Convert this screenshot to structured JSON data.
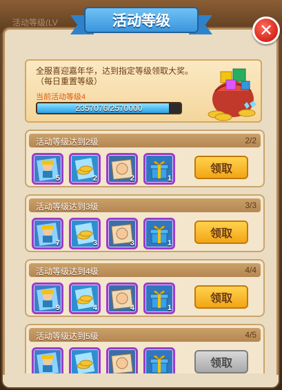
{
  "window": {
    "title": "活动等级",
    "background_text": "活动等级(LV"
  },
  "header": {
    "message": "全服喜迎嘉年华，达到指定等级领取大奖。（每日重置等级）",
    "level_label": "当前活动等级4",
    "progress": {
      "current": 2357076,
      "total": 2570000,
      "text": "2357076/2570000"
    }
  },
  "tasks": [
    {
      "title": "活动等级达到2级",
      "count": "2/2",
      "rewards": [
        {
          "icon": "worker-character-card",
          "qty": "5"
        },
        {
          "icon": "coin-item",
          "qty": "2"
        },
        {
          "icon": "hand-scroll-item",
          "qty": "2"
        },
        {
          "icon": "gift-box-icon",
          "qty": "1"
        }
      ],
      "button": {
        "label": "领取",
        "enabled": true
      }
    },
    {
      "title": "活动等级达到3级",
      "count": "3/3",
      "rewards": [
        {
          "icon": "worker-character-card",
          "qty": "7"
        },
        {
          "icon": "coin-item",
          "qty": "3"
        },
        {
          "icon": "hand-scroll-item",
          "qty": "3"
        },
        {
          "icon": "gift-box-icon",
          "qty": "1"
        }
      ],
      "button": {
        "label": "领取",
        "enabled": true
      }
    },
    {
      "title": "活动等级达到4级",
      "count": "4/4",
      "rewards": [
        {
          "icon": "worker-character-card",
          "qty": "9"
        },
        {
          "icon": "coin-item",
          "qty": "4"
        },
        {
          "icon": "hand-scroll-item",
          "qty": "4"
        },
        {
          "icon": "gift-box-icon",
          "qty": "1"
        }
      ],
      "button": {
        "label": "领取",
        "enabled": true
      }
    },
    {
      "title": "活动等级达到5级",
      "count": "4/5",
      "rewards": [
        {
          "icon": "worker-character-card",
          "qty": ""
        },
        {
          "icon": "coin-item",
          "qty": ""
        },
        {
          "icon": "hand-scroll-item",
          "qty": ""
        },
        {
          "icon": "gift-box-icon",
          "qty": ""
        }
      ],
      "button": {
        "label": "领取",
        "enabled": false
      }
    }
  ],
  "colors": {
    "ribbon": "#3b95dc",
    "claim_button": "#f2a516",
    "disabled_button": "#a9a9a9",
    "reward_border": "#9b3cc9",
    "progress": "#2aa2e8"
  }
}
